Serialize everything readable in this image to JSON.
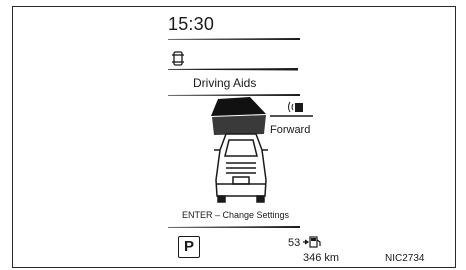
{
  "status": {
    "clock": "15:30"
  },
  "screen": {
    "title": "Driving Aids",
    "mode_label": "Forward",
    "hint": "ENTER – Change Settings"
  },
  "footer": {
    "gear": "P",
    "fuel_value": "53",
    "range": "346 km"
  },
  "figure_code": "NIC2734",
  "icons": [
    "driving-aids-car-icon",
    "sonar-icon",
    "vehicle-rear-icon",
    "fuel-pump-icon"
  ]
}
